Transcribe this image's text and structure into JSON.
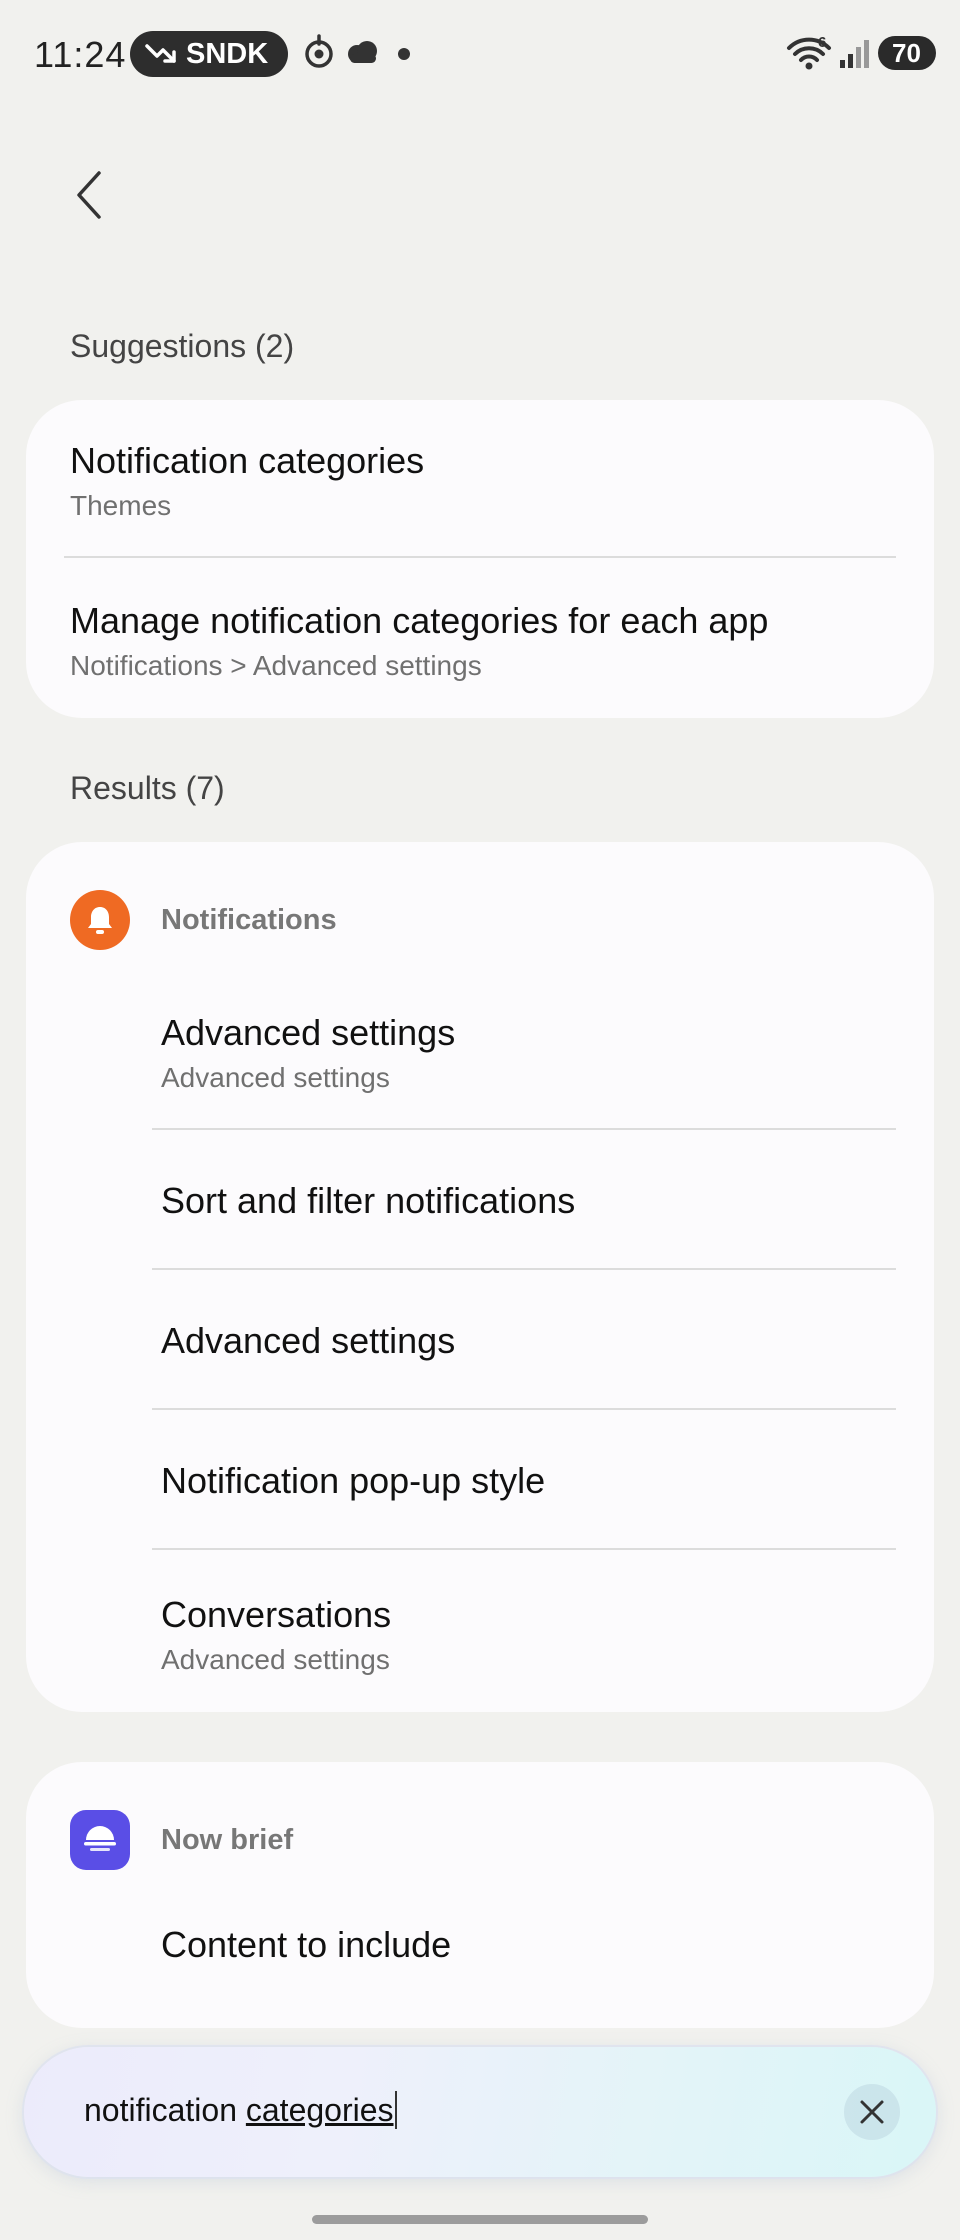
{
  "status_bar": {
    "time": "11:24",
    "ticker": "SNDK",
    "battery": "70",
    "wifi_badge": "6",
    "icons": [
      "trending-down-icon",
      "vpn-icon",
      "cloud-icon",
      "notification-dot-icon",
      "wifi-icon",
      "signal-icon",
      "battery-icon"
    ]
  },
  "header": {
    "back_icon": "back-chevron-icon"
  },
  "suggestions": {
    "title": "Suggestions (2)",
    "items": [
      {
        "title": "Notification categories",
        "subtitle": "Themes"
      },
      {
        "title": "Manage notification categories for each app",
        "subtitle": "Notifications > Advanced settings"
      }
    ]
  },
  "results": {
    "title": "Results (7)",
    "groups": [
      {
        "app": "Notifications",
        "icon": "bell-icon",
        "icon_color": "#ef6a23",
        "items": [
          {
            "title": "Advanced settings",
            "subtitle": "Advanced settings"
          },
          {
            "title": "Sort and filter notifications",
            "subtitle": ""
          },
          {
            "title": "Advanced settings",
            "subtitle": ""
          },
          {
            "title": "Notification pop-up style",
            "subtitle": ""
          },
          {
            "title": "Conversations",
            "subtitle": "Advanced settings"
          }
        ]
      },
      {
        "app": "Now brief",
        "icon": "now-brief-icon",
        "icon_color": "#5a4ee6",
        "items": [
          {
            "title": "Content to include",
            "subtitle": ""
          }
        ]
      }
    ]
  },
  "search": {
    "query_part1": "notification ",
    "query_part2": "categories",
    "clear_icon": "close-icon"
  },
  "colors": {
    "background": "#f1f1ee",
    "card": "#fcfbfd",
    "notifications_accent": "#ef6a23",
    "now_brief_accent": "#5a4ee6"
  }
}
